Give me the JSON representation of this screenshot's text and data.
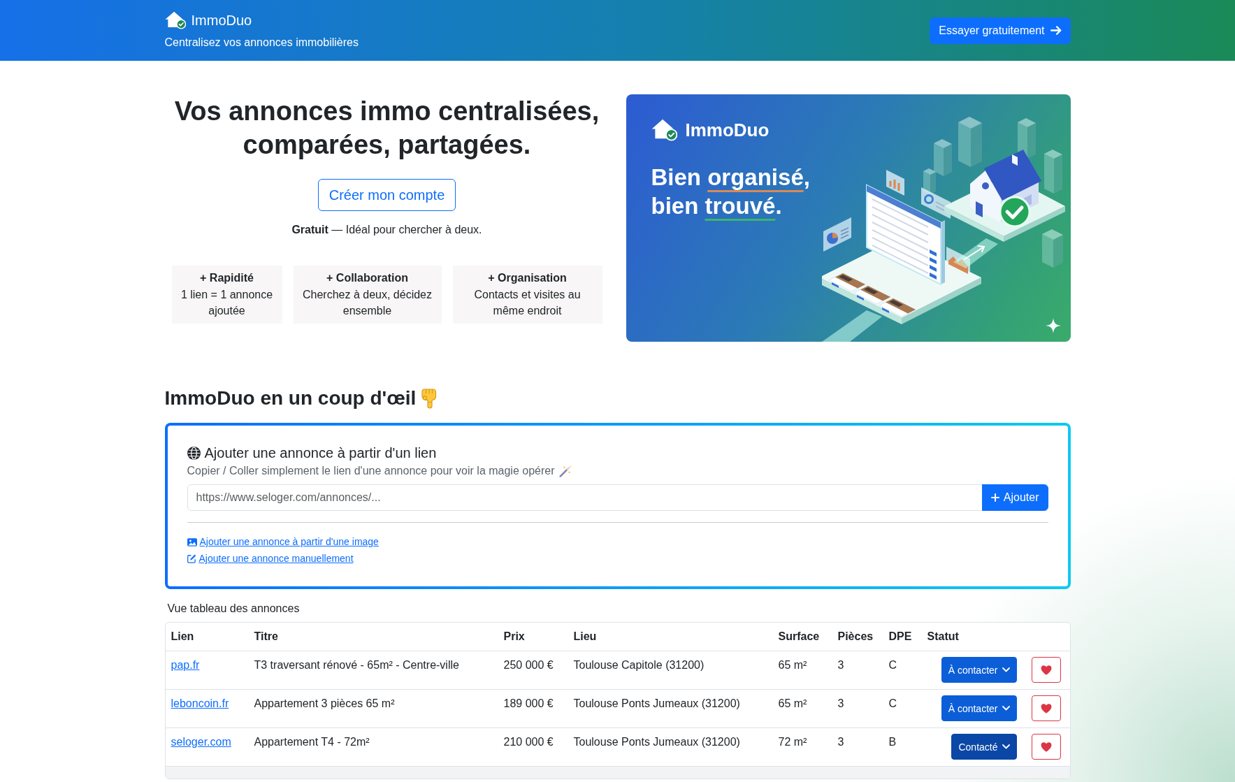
{
  "header": {
    "brand": "ImmoDuo",
    "tagline": "Centralisez vos annonces immobilières",
    "cta": "Essayer gratuitement"
  },
  "hero": {
    "title": "Vos annonces immo centralisées, comparées, partagées.",
    "button": "Créer mon compte",
    "note": "**Gratuit** — Idéal pour chercher à deux.",
    "features": [
      {
        "title": "+ Rapidité",
        "text": "1 lien = 1 annonce ajoutée"
      },
      {
        "title": "+ Collaboration",
        "text": "Cherchez à deux, décidez ensemble"
      },
      {
        "title": "+ Organisation",
        "text": "Contacts et visites au même endroit"
      }
    ]
  },
  "banner": {
    "brand": "ImmoDuo",
    "headline": [
      {
        "lead": "Bien",
        "underlined": "organisé",
        "tail": ","
      },
      {
        "lead": "bien",
        "underlined": "trouvé",
        "tail": "."
      }
    ]
  },
  "overview": {
    "title": "ImmoDuo en un coup d'œil"
  },
  "add_card": {
    "title": "Ajouter une annonce à partir d'un lien",
    "subtitle": "Copier / Coller simplement le lien d'une annonce pour voir la magie opérer",
    "url_field": {
      "placeholder": "https://www.seloger.com/annonces/..."
    },
    "add_button": "Ajouter",
    "links": [
      {
        "kind": "image",
        "label": "Ajouter une annonce à partir d'une image"
      },
      {
        "kind": "manual",
        "label": "Ajouter une annonce manuellement"
      }
    ]
  },
  "table": {
    "caption": "Vue tableau des annonces",
    "columns": [
      "Lien",
      "Titre",
      "Prix",
      "Lieu",
      "Surface",
      "Pièces",
      "DPE",
      "Statut"
    ],
    "rows": [
      {
        "link": "pap.fr",
        "title": "T3 traversant rénové - 65m² - Centre-ville",
        "price": "250 000 €",
        "location": "Toulouse Capitole (31200)",
        "surface": "65 m²",
        "rooms": "3",
        "dpe": "C",
        "status": {
          "label": "À contacter",
          "color": "#0b5ed7"
        }
      },
      {
        "link": "leboncoin.fr",
        "title": "Appartement 3 pièces 65 m²",
        "price": "189 000 €",
        "location": "Toulouse Ponts Jumeaux (31200)",
        "surface": "65 m²",
        "rooms": "3",
        "dpe": "C",
        "status": {
          "label": "À contacter",
          "color": "#0b5ed7"
        }
      },
      {
        "link": "seloger.com",
        "title": "Appartement T4 - 72m²",
        "price": "210 000 €",
        "location": "Toulouse Ponts Jumeaux (31200)",
        "surface": "72 m²",
        "rooms": "3",
        "dpe": "B",
        "status": {
          "label": "Contacté",
          "color": "#0a47a6"
        }
      }
    ]
  }
}
